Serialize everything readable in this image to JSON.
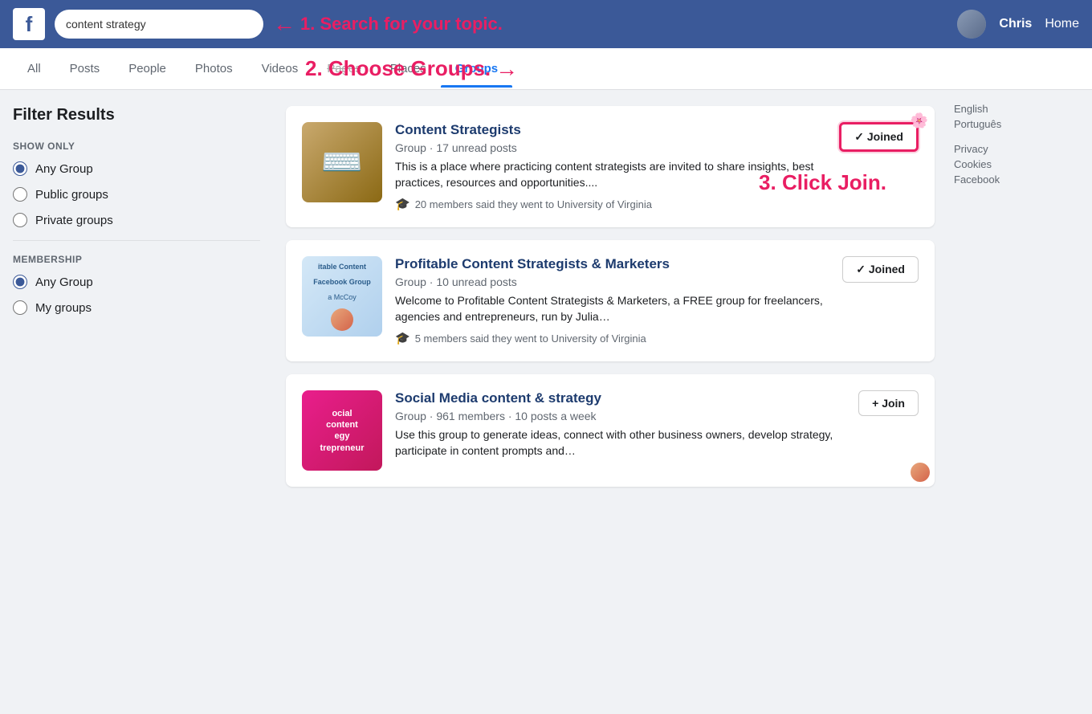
{
  "header": {
    "logo_text": "f",
    "search_value": "content strategy",
    "annotation1_arrow": "←",
    "annotation1_text": "1. Search for your topic.",
    "username": "Chris",
    "home_label": "Home"
  },
  "nav": {
    "tabs": [
      {
        "label": "All",
        "active": false,
        "strikethrough": false
      },
      {
        "label": "Posts",
        "active": false,
        "strikethrough": false
      },
      {
        "label": "People",
        "active": false,
        "strikethrough": false
      },
      {
        "label": "Photos",
        "active": false,
        "strikethrough": false
      },
      {
        "label": "Videos",
        "active": false,
        "strikethrough": false
      },
      {
        "label": "Pages",
        "active": false,
        "strikethrough": true
      },
      {
        "label": "Places",
        "active": false,
        "strikethrough": false
      },
      {
        "label": "Groups",
        "active": true,
        "strikethrough": false
      }
    ],
    "annotation2_text": "2. Choose Groups.",
    "annotation2_arrow": "→"
  },
  "sidebar": {
    "title": "Filter Results",
    "show_only_label": "SHOW ONLY",
    "show_only_options": [
      {
        "label": "Any Group",
        "checked": true
      },
      {
        "label": "Public groups",
        "checked": false
      },
      {
        "label": "Private groups",
        "checked": false
      }
    ],
    "membership_label": "MEMBERSHIP",
    "membership_options": [
      {
        "label": "Any Group",
        "checked": true
      },
      {
        "label": "My groups",
        "checked": false
      }
    ]
  },
  "groups": [
    {
      "name": "Content Strategists",
      "meta": "Group · 17 unread posts",
      "description": "This is a place where practicing content strategists are invited to share insights, best practices, resources and opportunities....",
      "education": "20 members said they went to University of Virginia",
      "button_label": "✓ Joined",
      "button_type": "joined",
      "highlighted": true,
      "img_type": "typewriter"
    },
    {
      "name": "Profitable Content Strategists & Marketers",
      "meta": "Group · 10 unread posts",
      "description": "Welcome to Profitable Content Strategists & Marketers, a FREE group for freelancers, agencies and entrepreneurs, run by Julia…",
      "education": "5 members said they went to University of Virginia",
      "button_label": "✓ Joined",
      "button_type": "joined",
      "highlighted": false,
      "img_type": "profitable"
    },
    {
      "name": "Social Media content & strategy",
      "meta": "Group · 961 members · 10 posts a week",
      "description": "Use this group to generate ideas, connect with other business owners, develop strategy, participate in content prompts and…",
      "education": "",
      "button_label": "+ Join",
      "button_type": "join",
      "highlighted": false,
      "img_type": "social"
    }
  ],
  "annotation3_text": "3. Click Join.",
  "right_sidebar": {
    "links": [
      "English",
      "Português",
      "",
      "Privacy",
      "Cookies",
      "Facebook"
    ]
  },
  "img_labels": {
    "typewriter": "🌸",
    "profitable": "itable Content\nFacebook Group\na McCoy",
    "social": "ocial\ncontent\negy\ntrepreneur"
  }
}
